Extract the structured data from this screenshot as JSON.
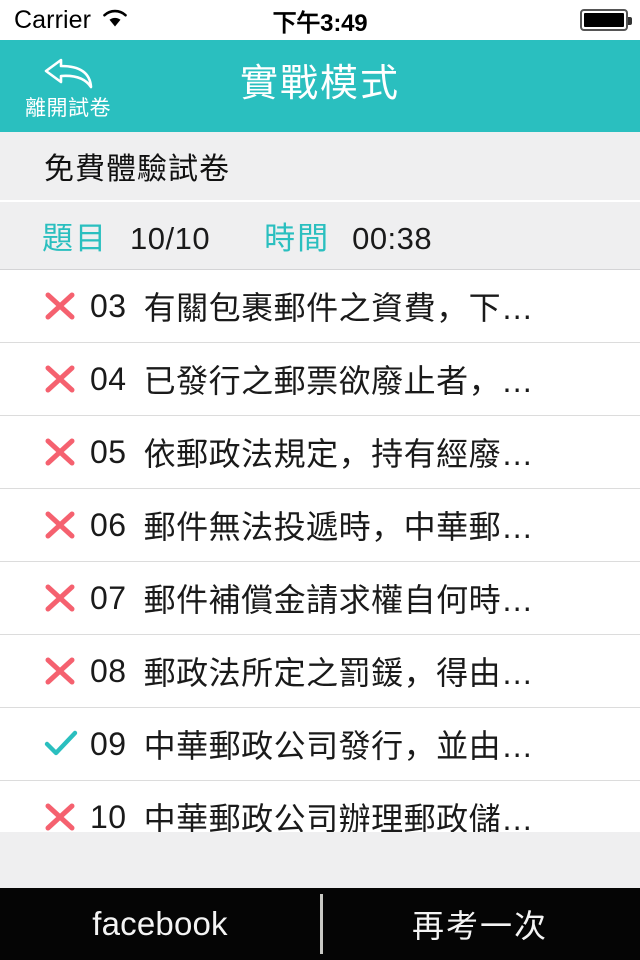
{
  "status_bar": {
    "carrier": "Carrier",
    "wifi_icon": "wifi-icon",
    "time": "下午3:49",
    "battery_icon": "battery-full-icon"
  },
  "nav_bar": {
    "back_icon": "back-arrow-icon",
    "back_label": "離開試卷",
    "title": "實戰模式",
    "background_color": "#2abfbf"
  },
  "paper": {
    "title": "免費體驗試卷"
  },
  "info_bar": {
    "question_label": "題目",
    "question_value": "10/10",
    "time_label": "時間",
    "time_value": "00:38",
    "label_color": "#2abfbf"
  },
  "question_list": {
    "correct_icon": "check-icon",
    "wrong_icon": "cross-icon",
    "correct_color": "#2abfbf",
    "wrong_color": "#f5616f",
    "rows": [
      {
        "mark": "wrong",
        "number": "03",
        "text": "有關包裹郵件之資費，下…"
      },
      {
        "mark": "wrong",
        "number": "04",
        "text": "已發行之郵票欲廢止者，…"
      },
      {
        "mark": "wrong",
        "number": "05",
        "text": "依郵政法規定，持有經廢…"
      },
      {
        "mark": "wrong",
        "number": "06",
        "text": "郵件無法投遞時，中華郵…"
      },
      {
        "mark": "wrong",
        "number": "07",
        "text": "郵件補償金請求權自何時…"
      },
      {
        "mark": "wrong",
        "number": "08",
        "text": "郵政法所定之罰鍰，得由…"
      },
      {
        "mark": "correct",
        "number": "09",
        "text": "中華郵政公司發行，並由…"
      },
      {
        "mark": "wrong",
        "number": "10",
        "text": "中華郵政公司辦理郵政儲…"
      }
    ]
  },
  "toolbar": {
    "facebook_label": "facebook",
    "retry_label": "再考一次",
    "background_color": "#050505"
  }
}
